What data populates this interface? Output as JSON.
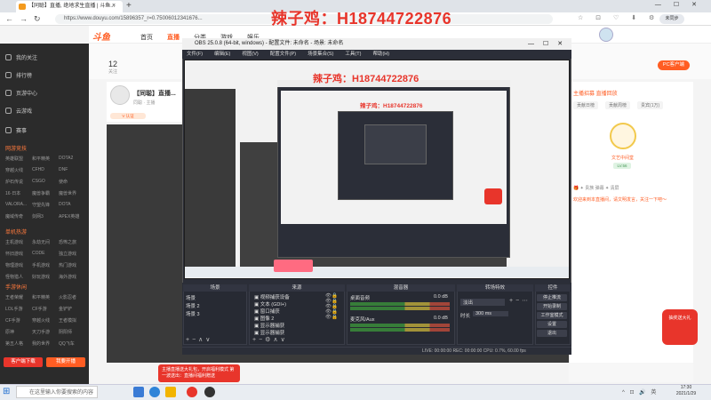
{
  "browser": {
    "tab_title": "【同聪】直播, 绝地求生直播 | 斗鱼...",
    "url": "https://www.douyu.com/15896357_r=0.75006012341676...",
    "login_label": "未同步"
  },
  "site": {
    "logo": "斗鱼",
    "nav": [
      "首页",
      "直播",
      "分类",
      "游戏",
      "娱乐"
    ],
    "follow_count": "12",
    "follow_label": "关注",
    "pc_client": "PC客户端"
  },
  "sidebar": {
    "top_items": [
      "我的关注",
      "排行榜",
      "页游中心",
      "云游戏",
      "赛事"
    ],
    "section_online": "网游竞技",
    "online_games": [
      "英雄联盟",
      "和平精英",
      "DOTA2",
      "穿越火线",
      "CFHD",
      "DNF",
      "炉石传说",
      "CSGO",
      "使命",
      "16·日本",
      "魔兽争霸",
      "魔兽世界",
      "VALORA...",
      "守望先锋",
      "DOTA",
      "魔域传奇",
      "剑网3",
      "APEX英雄"
    ],
    "section_single": "单机热游",
    "single_games": [
      "主机游戏",
      "永劫无间",
      "恐怖之旅",
      "怀旧游戏",
      "CODE",
      "独立游戏",
      "物理游戏",
      "手机游戏",
      "热门游戏",
      "怪物猎人",
      "好玩游戏",
      "海外游戏"
    ],
    "section_mobile": "手游休闲",
    "mobile_games": [
      "王者荣耀",
      "和平精英",
      "火影忍者",
      "LOL手游",
      "CF手游",
      "金铲铲",
      "CF手游",
      "穿越火线",
      "王者模拟",
      "原神",
      "天刀手游",
      "阴阳师",
      "第五人格",
      "我的世界",
      "QQ飞车"
    ],
    "btn_download": "客户端下载",
    "btn_live": "我要开播"
  },
  "room": {
    "title": "【同聪】直播...",
    "tag_text": "同聪 · 主播",
    "badge": "热度榜 · 1.1亿",
    "v_badge": "V 认证"
  },
  "chat": {
    "tabs": "主播招募    直播回放",
    "rank_tabs": [
      "贡献日榜",
      "贡献周榜",
      "贵宾(1万)"
    ],
    "top_name": "文艺中间堂",
    "top_level": "LV.56",
    "gift_bar": "🎁 ✦ 贵族 弹幕 ✦ 清屏",
    "chat_msg": "欢迎来到本直播间，请文明发言，关注一下吧～",
    "float_label": "抽奖送大礼"
  },
  "overlay": {
    "main_text": "辣子鸡：H18744722876",
    "inner_text": "辣子鸡：H18744722876",
    "inner_text_small": "辣子鸡：H18744722876"
  },
  "obs": {
    "title": "OBS 25.0.8 (64-bit, windows) - 配置文件: 未命名 - 场景: 未命名",
    "menu": [
      "文件(F)",
      "编辑(E)",
      "视图(V)",
      "配置文件(P)",
      "场景集合(S)",
      "工具(T)",
      "帮助(H)"
    ],
    "scenes_title": "场景",
    "scenes": [
      "场景",
      "场景 2",
      "场景 3"
    ],
    "sources_title": "来源",
    "sources": [
      "视频捕获设备",
      "文本 (GDI+)",
      "窗口捕获",
      "图像 2",
      "显示器捕获",
      "显示器捕获"
    ],
    "mixer_title": "混音器",
    "mixer": [
      {
        "name": "桌面音频",
        "db": "0.0 dB"
      },
      {
        "name": "麦克风/Aux",
        "db": "0.0 dB"
      }
    ],
    "transition_title": "转场特效",
    "transition_type": "淡出",
    "duration_label": "时长",
    "duration_value": "300 ms",
    "controls_title": "控件",
    "controls": [
      "停止推流",
      "开始录制",
      "工作室模式",
      "设置",
      "退出"
    ],
    "status": "LIVE: 00:00:00   REC: 00:00:00   CPU: 0.7%, 60.00 fps"
  },
  "notice": {
    "text": "主播直播送大礼包，开启福利模式 第一波送出：直播间福利赠送"
  },
  "taskbar": {
    "search_placeholder": "在这里输入你要搜索的内容",
    "tray": "^ ⊡ 🔊 英",
    "time": "17:30",
    "date": "2021/1/29"
  }
}
